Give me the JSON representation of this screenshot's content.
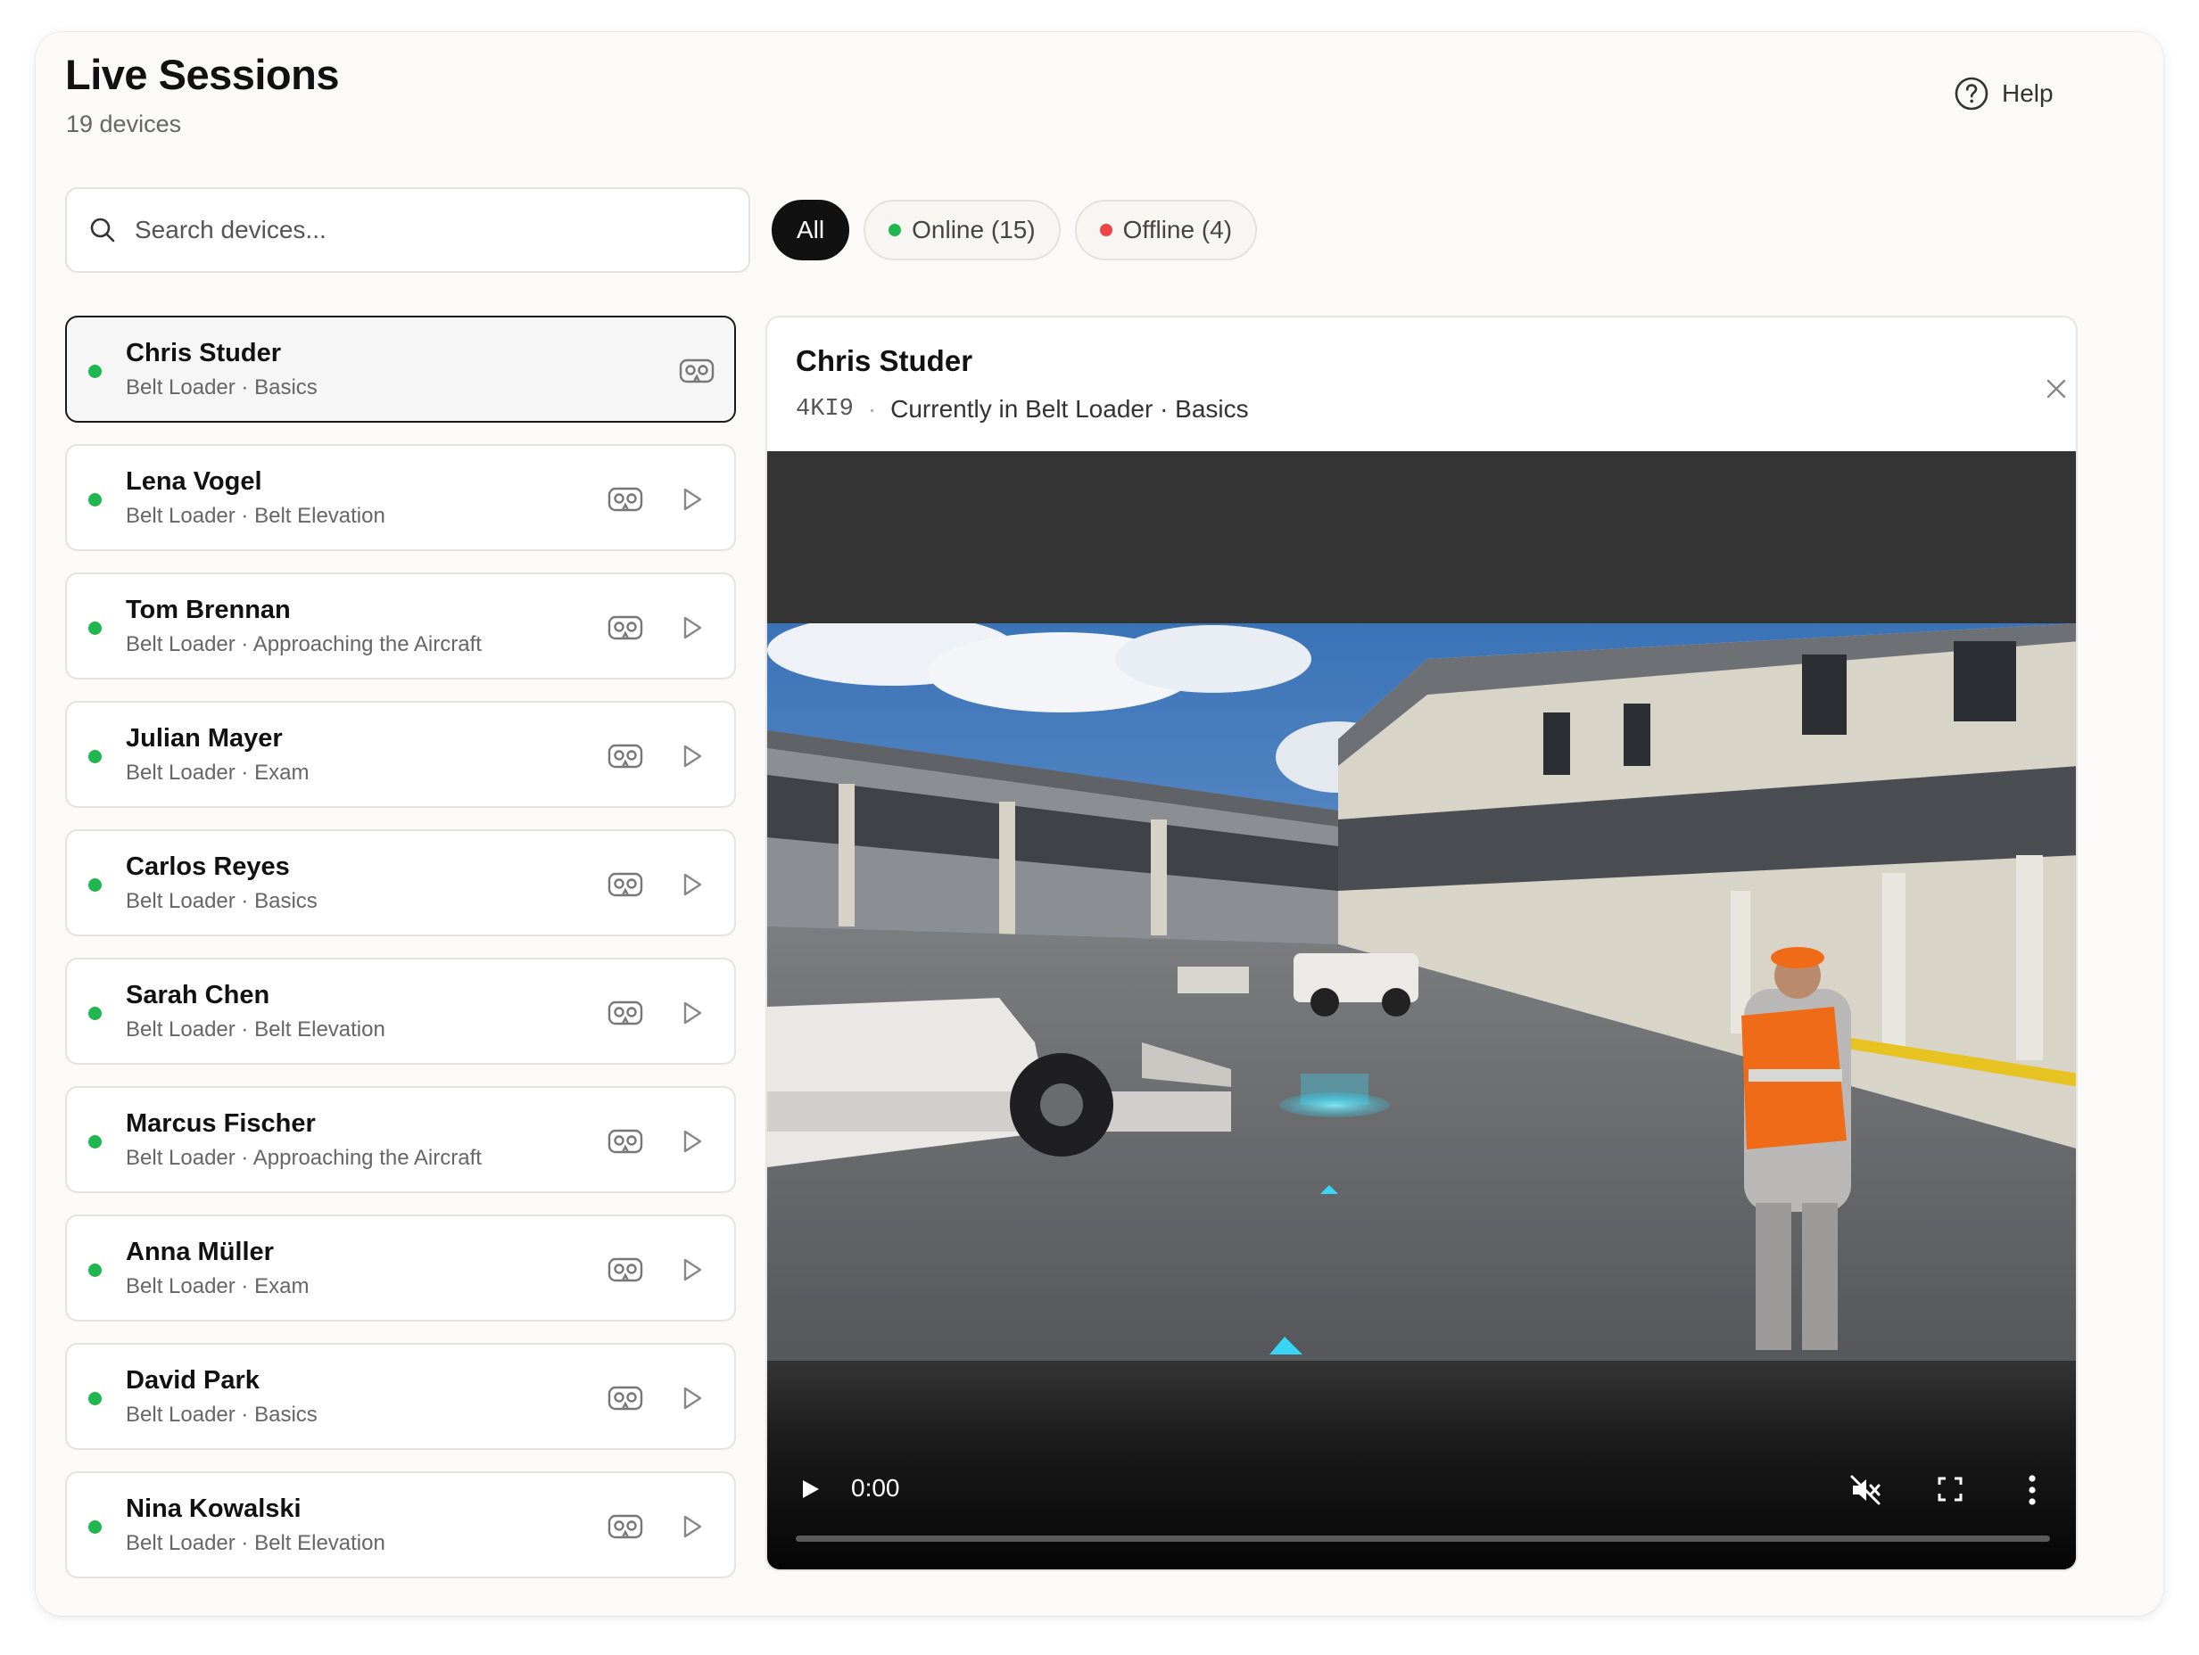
{
  "header": {
    "title": "Live Sessions",
    "subtitle": "19 devices",
    "help_label": "Help"
  },
  "search": {
    "placeholder": "Search devices...",
    "value": ""
  },
  "filters": {
    "all_label": "All",
    "online_label": "Online (15)",
    "offline_label": "Offline (4)",
    "active": "All"
  },
  "colors": {
    "online": "#1fb84e",
    "offline": "#ef4444",
    "accent": "#111111"
  },
  "devices": [
    {
      "name": "Chris Studer",
      "meta": "Belt Loader · Basics",
      "status": "online",
      "selected": true
    },
    {
      "name": "Lena Vogel",
      "meta": "Belt Loader · Belt Elevation",
      "status": "online"
    },
    {
      "name": "Tom Brennan",
      "meta": "Belt Loader · Approaching the Aircraft",
      "status": "online"
    },
    {
      "name": "Julian Mayer",
      "meta": "Belt Loader · Exam",
      "status": "online"
    },
    {
      "name": "Carlos Reyes",
      "meta": "Belt Loader · Basics",
      "status": "online"
    },
    {
      "name": "Sarah Chen",
      "meta": "Belt Loader · Belt Elevation",
      "status": "online"
    },
    {
      "name": "Marcus Fischer",
      "meta": "Belt Loader · Approaching the Aircraft",
      "status": "online"
    },
    {
      "name": "Anna Müller",
      "meta": "Belt Loader · Exam",
      "status": "online"
    },
    {
      "name": "David Park",
      "meta": "Belt Loader · Basics",
      "status": "online"
    },
    {
      "name": "Nina Kowalski",
      "meta": "Belt Loader · Belt Elevation",
      "status": "online"
    }
  ],
  "detail": {
    "name": "Chris Studer",
    "device_code": "4KI9",
    "separator": "·",
    "current_activity": "Currently in Belt Loader · Basics"
  },
  "video": {
    "time": "0:00",
    "progress": 0,
    "muted": true
  }
}
